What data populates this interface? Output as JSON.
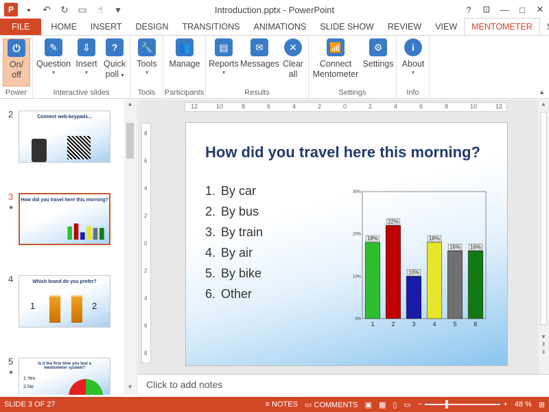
{
  "window": {
    "title": "Introduction.pptx - PowerPoint",
    "controls": [
      "?",
      "⊡",
      "—",
      "□",
      "✕"
    ]
  },
  "tabs": [
    "FILE",
    "HOME",
    "INSERT",
    "DESIGN",
    "TRANSITIONS",
    "ANIMATIONS",
    "SLIDE SHOW",
    "REVIEW",
    "VIEW",
    "MENTOMETER",
    "Si"
  ],
  "ribbon": {
    "groups": [
      {
        "label": "Power",
        "buttons": [
          {
            "label": "On/",
            "label2": "off"
          }
        ]
      },
      {
        "label": "Interactive slides",
        "buttons": [
          {
            "label": "Question"
          },
          {
            "label": "Insert"
          },
          {
            "label": "Quick",
            "label2": "poll"
          }
        ]
      },
      {
        "label": "Tools",
        "buttons": [
          {
            "label": "Tools"
          }
        ]
      },
      {
        "label": "Participants",
        "buttons": [
          {
            "label": "Manage"
          }
        ]
      },
      {
        "label": "Results",
        "buttons": [
          {
            "label": "Reports"
          },
          {
            "label": "Messages"
          },
          {
            "label": "Clear",
            "label2": "all"
          }
        ]
      },
      {
        "label": "Settings",
        "buttons": [
          {
            "label": "Connect",
            "label2": "Mentometer"
          },
          {
            "label": "Settings"
          }
        ]
      },
      {
        "label": "Info",
        "buttons": [
          {
            "label": "About"
          }
        ]
      }
    ]
  },
  "thumbnails": [
    {
      "num": "2",
      "title": "Connect web-keypads...",
      "star": false
    },
    {
      "num": "3",
      "title": "How did you travel here this morning?",
      "star": true
    },
    {
      "num": "4",
      "title": "Which brand do you prefer?",
      "star": false,
      "labels": [
        "1",
        "2"
      ]
    },
    {
      "num": "5",
      "title": "Is it the first time you test a mentometer system?",
      "star": true,
      "options": [
        "1.Yes",
        "2.No"
      ]
    }
  ],
  "ruler": {
    "h_labels": [
      "12",
      "10",
      "8",
      "6",
      "4",
      "2",
      "0",
      "2",
      "4",
      "6",
      "8",
      "10",
      "12"
    ],
    "v_labels": [
      "8",
      "6",
      "4",
      "2",
      "0",
      "2",
      "4",
      "6",
      "8"
    ]
  },
  "slide": {
    "title": "How did you travel here this morning?",
    "options": [
      "By car",
      "By bus",
      "By train",
      "By air",
      "By bike",
      "Other"
    ]
  },
  "chart_data": {
    "type": "bar",
    "categories": [
      "1",
      "2",
      "3",
      "4",
      "5",
      "6"
    ],
    "values": [
      18,
      22,
      10,
      18,
      16,
      16
    ],
    "data_labels": [
      "18%",
      "22%",
      "10%",
      "18%",
      "16%",
      "16%"
    ],
    "ylim": [
      0,
      30
    ],
    "yticks": [
      "0%",
      "10%",
      "20%",
      "30%"
    ],
    "colors": [
      "#2dbf2d",
      "#c00000",
      "#1a1aa8",
      "#e6e62a",
      "#707070",
      "#137a13"
    ],
    "grid": false
  },
  "notes_placeholder": "Click to add notes",
  "status": {
    "slide": "SLIDE 3 OF 27",
    "notes": "NOTES",
    "comments": "COMMENTS",
    "zoom": "48 %"
  }
}
